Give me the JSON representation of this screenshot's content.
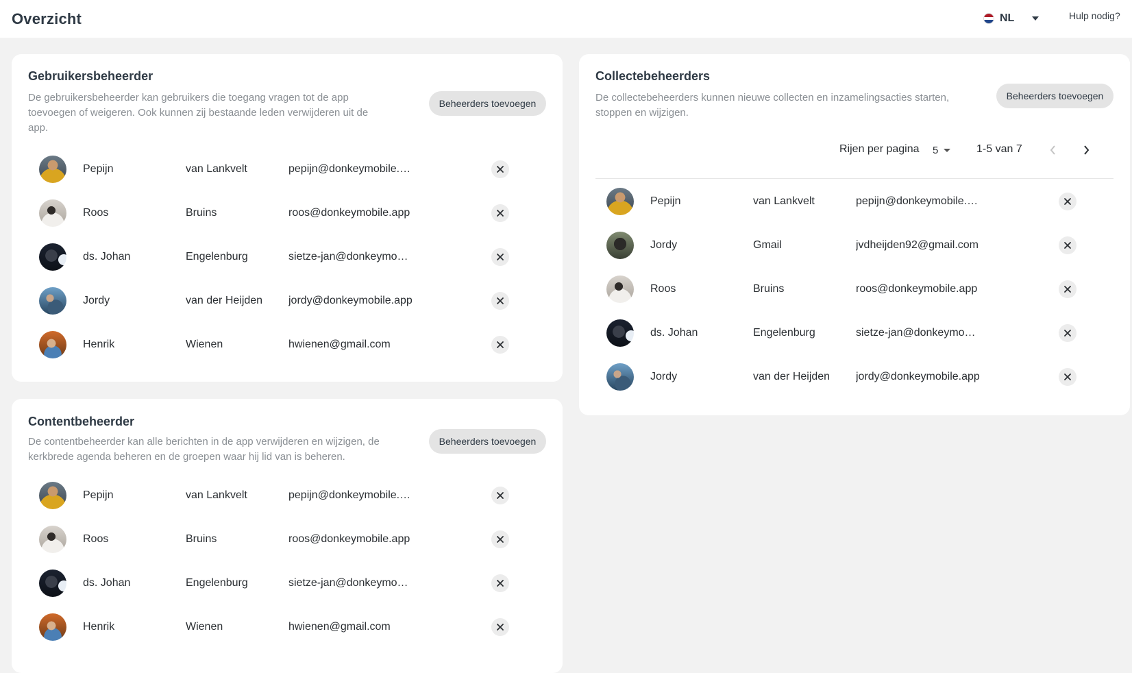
{
  "header": {
    "title": "Overzicht",
    "language": "NL",
    "help": "Hulp nodig?"
  },
  "colors": {
    "page_bg": "#f2f2f2",
    "card_bg": "#ffffff",
    "pill_bg": "#e4e4e4",
    "muted_text": "#8a8f94",
    "flag_red": "#ae1c28",
    "flag_white": "#ffffff",
    "flag_blue": "#21468b"
  },
  "user_admins": {
    "title": "Gebruikersbeheerder",
    "description": "De gebruikersbeheerder kan gebruikers die toegang vragen tot de app toevoegen of weigeren. Ook kunnen zij bestaande leden verwijderen uit de app.",
    "add_label": "Beheerders toevoegen",
    "rows": [
      {
        "first": "Pepijn",
        "last": "van Lankvelt",
        "email": "pepijn@donkeymobile.a...",
        "avatar": "avatar-pepijn"
      },
      {
        "first": "Roos",
        "last": "Bruins",
        "email": "roos@donkeymobile.app",
        "avatar": "avatar-roos"
      },
      {
        "first": "ds. Johan",
        "last": "Engelenburg",
        "email": "sietze-jan@donkeymobi...",
        "avatar": "avatar-johan"
      },
      {
        "first": "Jordy",
        "last": "van der Heijden",
        "email": "jordy@donkeymobile.app",
        "avatar": "avatar-jordy"
      },
      {
        "first": "Henrik",
        "last": "Wienen",
        "email": "hwienen@gmail.com",
        "avatar": "avatar-henrik"
      }
    ]
  },
  "content_admins": {
    "title": "Contentbeheerder",
    "description": "De contentbeheerder kan alle berichten in de app verwijderen en wijzigen, de kerkbrede agenda beheren en de groepen waar hij lid van is beheren.",
    "add_label": "Beheerders toevoegen",
    "rows": [
      {
        "first": "Pepijn",
        "last": "van Lankvelt",
        "email": "pepijn@donkeymobile.a...",
        "avatar": "avatar-pepijn"
      },
      {
        "first": "Roos",
        "last": "Bruins",
        "email": "roos@donkeymobile.app",
        "avatar": "avatar-roos"
      },
      {
        "first": "ds. Johan",
        "last": "Engelenburg",
        "email": "sietze-jan@donkeymobi...",
        "avatar": "avatar-johan"
      },
      {
        "first": "Henrik",
        "last": "Wienen",
        "email": "hwienen@gmail.com",
        "avatar": "avatar-henrik"
      }
    ]
  },
  "collection_admins": {
    "title": "Collectebeheerders",
    "description": "De collectebeheerders kunnen nieuwe collecten en inzamelingsacties starten, stoppen en wijzigen.",
    "add_label": "Beheerders toevoegen",
    "pagination": {
      "rows_per_page_label": "Rijen per pagina",
      "rows_per_page": "5",
      "range": "1-5 van 7"
    },
    "rows": [
      {
        "first": "Pepijn",
        "last": "van Lankvelt",
        "email": "pepijn@donkeymobile.a...",
        "avatar": "avatar-pepijn"
      },
      {
        "first": "Jordy",
        "last": "Gmail",
        "email": "jvdheijden92@gmail.com",
        "avatar": "avatar-jordy-cat"
      },
      {
        "first": "Roos",
        "last": "Bruins",
        "email": "roos@donkeymobile.app",
        "avatar": "avatar-roos"
      },
      {
        "first": "ds. Johan",
        "last": "Engelenburg",
        "email": "sietze-jan@donkeymobi...",
        "avatar": "avatar-johan"
      },
      {
        "first": "Jordy",
        "last": "van der Heijden",
        "email": "jordy@donkeymobile.app",
        "avatar": "avatar-jordy"
      }
    ]
  }
}
